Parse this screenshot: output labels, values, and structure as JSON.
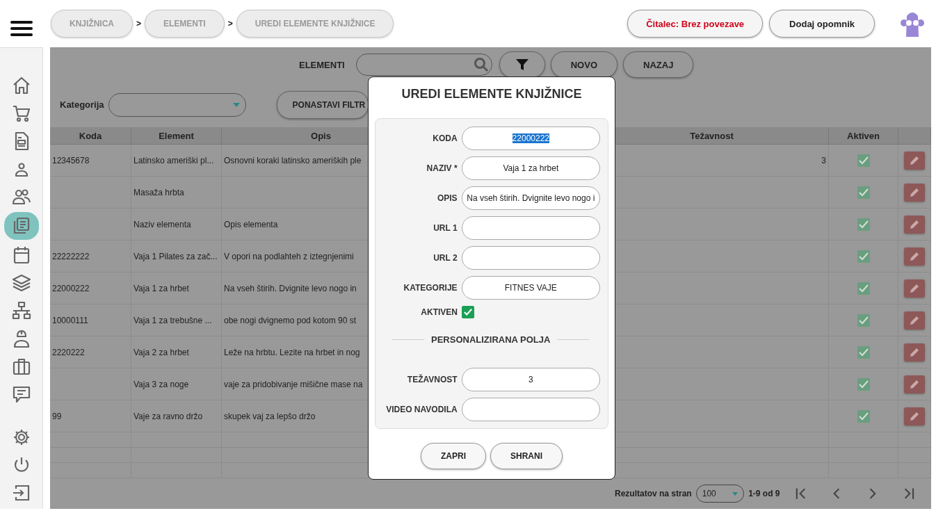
{
  "breadcrumbs": [
    "KNJIŽNICA",
    "ELEMENTI",
    "UREDI ELEMENTE KNJIŽNICE"
  ],
  "breadcrumb_separators": [
    ">",
    ">"
  ],
  "header_buttons": [
    {
      "label": "Čitalec: Brez povezave",
      "kind": "alert"
    },
    {
      "label": "Dodaj opomnik",
      "kind": "normal"
    }
  ],
  "sidebar": {
    "items": [
      {
        "selected": false
      },
      {
        "selected": false
      },
      {
        "selected": false
      },
      {
        "selected": false
      },
      {
        "selected": false
      },
      {
        "selected": true
      },
      {
        "selected": false
      },
      {
        "selected": false
      },
      {
        "selected": false
      },
      {
        "selected": false
      },
      {
        "selected": false
      },
      {
        "selected": false
      }
    ],
    "bottom_items": [
      {
        "selected": false
      },
      {
        "selected": false
      },
      {
        "selected": false
      }
    ]
  },
  "toolbar": {
    "label": "ELEMENTI",
    "buttons": [
      "NOVO",
      "NAZAJ"
    ]
  },
  "filter": {
    "label": "Kategorija",
    "reset_button": "PONASTAVI FILTR"
  },
  "table": {
    "columns": [
      "Koda",
      "Element",
      "Opis",
      "Težavnost",
      "Aktiven"
    ],
    "rows": [
      {
        "koda": "12345678",
        "element": "Latinsko ameriški pl...",
        "opis": "Osnovni koraki latinsko ameriških ple",
        "tezavnost": "3",
        "aktiven": true
      },
      {
        "element": "Masaža hrbta",
        "aktiven": true
      },
      {
        "element": "Naziv elementa",
        "opis": "Opis elementa",
        "aktiven": true
      },
      {
        "koda": "22222222",
        "element": "Vaja 1 Pilates za zač...",
        "opis": "V opori na podlahteh z iztegnjenimi",
        "aktiven": true
      },
      {
        "koda": "22000222",
        "element": "Vaja 1 za hrbet",
        "opis": "Na vseh štirih. Dvignite levo nogo in",
        "aktiven": true
      },
      {
        "koda": "10000111",
        "element": "Vaja 1 za trebušne ...",
        "opis": "obe nogi dvignemo pod kotom 90 st",
        "aktiven": true
      },
      {
        "koda": "2220222",
        "element": "Vaja 2 za hrbet",
        "opis": "Leže na hrbtu. Lezite na hrbet in nog",
        "aktiven": true
      },
      {
        "element": "Vaja 3 za noge",
        "opis": "vaje za pridobivanje mišične mase na",
        "aktiven": true
      },
      {
        "koda": "99",
        "element": "Vaje za ravno držo",
        "opis": "skupek vaj za lepšo držo",
        "aktiven": true
      }
    ]
  },
  "pagination": {
    "label": "Rezultatov na stran",
    "page_size": "100",
    "range": "1-9 od 9"
  },
  "modal": {
    "title": "UREDI ELEMENTE KNJIŽNICE",
    "fields": [
      {
        "kind": "text",
        "label": "KODA",
        "value": "22000222",
        "text_selected": true
      },
      {
        "kind": "text",
        "label": "NAZIV *",
        "value": "Vaja 1 za hrbet"
      },
      {
        "kind": "text",
        "label": "OPIS",
        "value": "Na vseh štirih. Dvignite levo nogo i"
      },
      {
        "kind": "text",
        "label": "URL 1"
      },
      {
        "kind": "text",
        "label": "URL 2"
      },
      {
        "kind": "text",
        "label": "KATEGORIJE",
        "value": "FITNES VAJE"
      },
      {
        "kind": "checkbox",
        "label": "AKTIVEN",
        "checked": true
      }
    ],
    "section_title": "PERSONALIZIRANA POLJA",
    "custom_fields": [
      {
        "kind": "text",
        "label": "TEŽAVNOST",
        "value": "3"
      },
      {
        "kind": "text",
        "label": "VIDEO NAVODILA"
      }
    ],
    "buttons": [
      "ZAPRI",
      "SHRANI"
    ]
  }
}
